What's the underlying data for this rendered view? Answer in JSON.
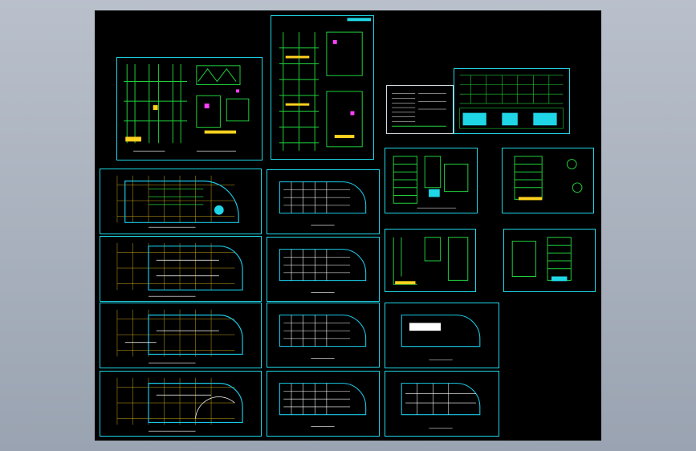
{
  "viewport": {
    "background": "#a8b0bc",
    "canvas_color": "#000000"
  },
  "colors": {
    "frame": "#1fd6e6",
    "wall": "#19c8e6",
    "grid": "#ffd21f",
    "green": "#20d03c",
    "white": "#ffffff",
    "magenta": "#ff40ff"
  },
  "sheets": [
    {
      "id": "detail-a",
      "kind": "details"
    },
    {
      "id": "stair-sections",
      "kind": "sections"
    },
    {
      "id": "notes-table",
      "kind": "notes"
    },
    {
      "id": "door-window-schedule",
      "kind": "schedule"
    },
    {
      "id": "elevation-1",
      "kind": "elevation"
    },
    {
      "id": "elevation-2",
      "kind": "elevation"
    },
    {
      "id": "elevation-3",
      "kind": "elevation"
    },
    {
      "id": "elevation-4",
      "kind": "elevation"
    },
    {
      "id": "plan-large-1",
      "kind": "plan"
    },
    {
      "id": "plan-large-2",
      "kind": "plan"
    },
    {
      "id": "plan-large-3",
      "kind": "plan"
    },
    {
      "id": "plan-large-4",
      "kind": "plan"
    },
    {
      "id": "plan-small-1",
      "kind": "plan"
    },
    {
      "id": "plan-small-2",
      "kind": "plan"
    },
    {
      "id": "plan-small-3",
      "kind": "plan"
    },
    {
      "id": "plan-small-4",
      "kind": "plan"
    },
    {
      "id": "roof-plan-1",
      "kind": "roof"
    },
    {
      "id": "roof-plan-2",
      "kind": "roof"
    }
  ]
}
